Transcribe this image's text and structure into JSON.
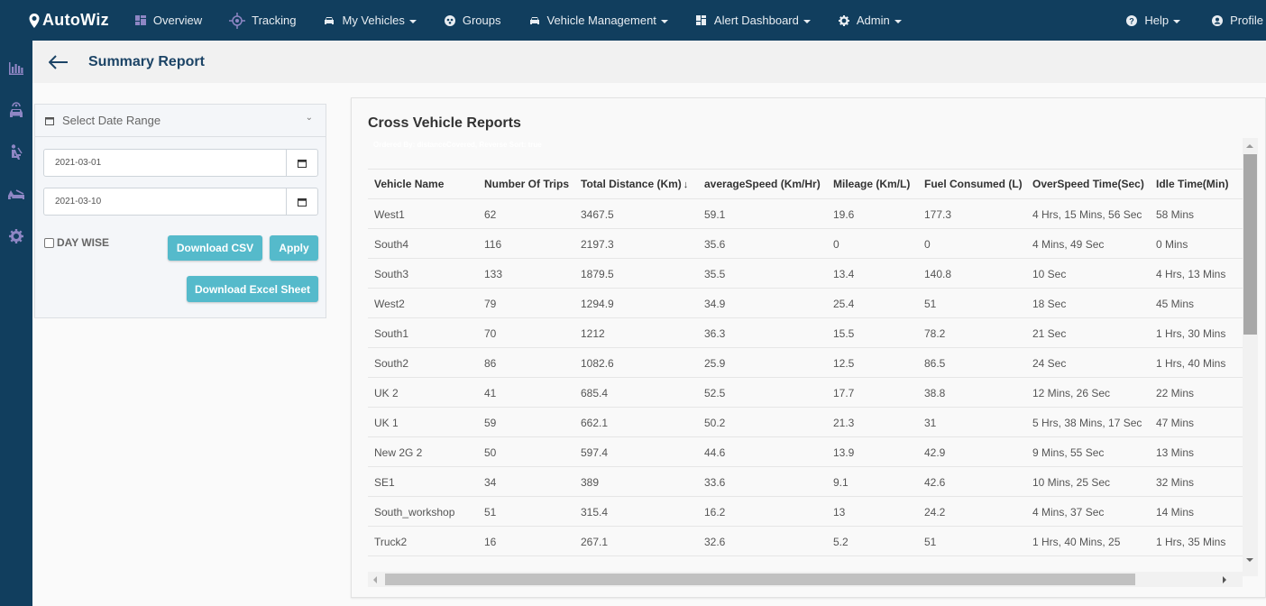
{
  "nav": {
    "brand": "AutoWiz",
    "items": [
      {
        "label": "Overview",
        "icon": "overview-icon",
        "dropdown": false
      },
      {
        "label": "Tracking",
        "icon": "tracking-icon",
        "dropdown": false
      },
      {
        "label": "My Vehicles",
        "icon": "car-icon",
        "dropdown": true
      },
      {
        "label": "Groups",
        "icon": "groups-icon",
        "dropdown": false
      },
      {
        "label": "Vehicle Management",
        "icon": "car-icon",
        "dropdown": true
      },
      {
        "label": "Alert Dashboard",
        "icon": "dashboard-icon",
        "dropdown": true
      },
      {
        "label": "Admin",
        "icon": "gear-icon",
        "dropdown": true
      }
    ],
    "right": [
      {
        "label": "Help",
        "icon": "help-icon",
        "dropdown": true
      },
      {
        "label": "Profile",
        "icon": "profile-icon",
        "dropdown": false
      }
    ]
  },
  "sidebar": {
    "items": [
      {
        "icon": "bar-chart-icon"
      },
      {
        "icon": "car-service-icon"
      },
      {
        "icon": "driver-icon"
      },
      {
        "icon": "car-repair-icon"
      },
      {
        "icon": "settings-icon"
      }
    ]
  },
  "header": {
    "title": "Summary Report"
  },
  "filter": {
    "title": "Select Date Range",
    "start_date": "2021-03-01",
    "end_date": "2021-03-10",
    "day_wise_label": "DAY WISE",
    "day_wise_checked": false,
    "download_csv_label": "Download CSV",
    "apply_label": "Apply",
    "download_excel_label": "Download Excel Sheet"
  },
  "report": {
    "title": "Cross Vehicle Reports",
    "order_note": "Ordered By: distanceCovered, Reverse Sort: true",
    "columns": [
      "Vehicle Name",
      "Number Of Trips",
      "Total Distance (Km)",
      "averageSpeed (Km/Hr)",
      "Mileage (Km/L)",
      "Fuel Consumed (L)",
      "OverSpeed Time(Sec)",
      "Idle Time(Min)"
    ],
    "sort_indicator": "↓",
    "rows": [
      [
        "West1",
        "62",
        "3467.5",
        "59.1",
        "19.6",
        "177.3",
        "4 Hrs, 15 Mins, 56 Sec",
        "58 Mins"
      ],
      [
        "South4",
        "116",
        "2197.3",
        "35.6",
        "0",
        "0",
        "4 Mins, 49 Sec",
        "0 Mins"
      ],
      [
        "South3",
        "133",
        "1879.5",
        "35.5",
        "13.4",
        "140.8",
        "10 Sec",
        "4 Hrs, 13 Mins"
      ],
      [
        "West2",
        "79",
        "1294.9",
        "34.9",
        "25.4",
        "51",
        "18 Sec",
        "45 Mins"
      ],
      [
        "South1",
        "70",
        "1212",
        "36.3",
        "15.5",
        "78.2",
        "21 Sec",
        "1 Hrs, 30 Mins"
      ],
      [
        "South2",
        "86",
        "1082.6",
        "25.9",
        "12.5",
        "86.5",
        "24 Sec",
        "1 Hrs, 40 Mins"
      ],
      [
        "UK 2",
        "41",
        "685.4",
        "52.5",
        "17.7",
        "38.8",
        "12 Mins, 26 Sec",
        "22 Mins"
      ],
      [
        "UK 1",
        "59",
        "662.1",
        "50.2",
        "21.3",
        "31",
        "5 Hrs, 38 Mins, 17 Sec",
        "47 Mins"
      ],
      [
        "New 2G 2",
        "50",
        "597.4",
        "44.6",
        "13.9",
        "42.9",
        "9 Mins, 55 Sec",
        "13 Mins"
      ],
      [
        "SE1",
        "34",
        "389",
        "33.6",
        "9.1",
        "42.6",
        "10 Mins, 25 Sec",
        "32 Mins"
      ],
      [
        "South_workshop",
        "51",
        "315.4",
        "16.2",
        "13",
        "24.2",
        "4 Mins, 37 Sec",
        "14 Mins"
      ],
      [
        "Truck2",
        "16",
        "267.1",
        "32.6",
        "5.2",
        "51",
        "1 Hrs, 40 Mins, 25",
        "1 Hrs, 35 Mins"
      ]
    ]
  },
  "colors": {
    "nav_bg": "#113e5e",
    "accent_button": "#55bacb",
    "title_blue": "#1c4466",
    "icon_purple": "#8e86c4"
  }
}
